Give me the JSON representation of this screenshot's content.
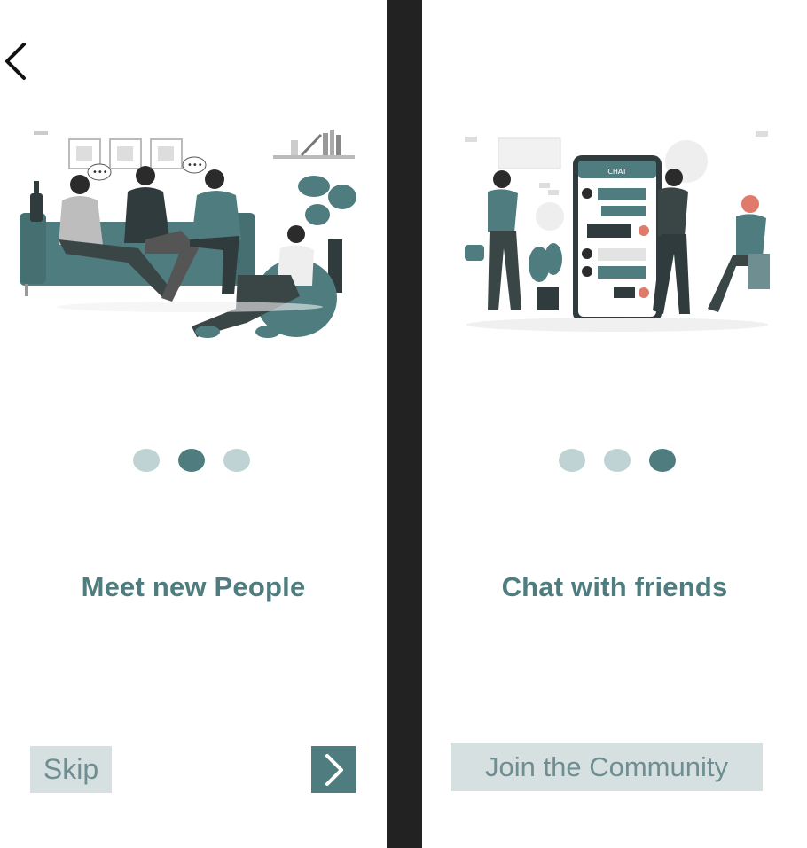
{
  "colors": {
    "accent": "#4f7d7f",
    "dot_inactive": "#bfd2d4",
    "button_bg": "#d7e0e1",
    "button_text": "#6f8e91",
    "divider": "#222222"
  },
  "left_screen": {
    "back_icon": "chevron-left-icon",
    "illustration": "friends-on-couch-illustration",
    "pager": {
      "total": 3,
      "active_index": 1
    },
    "title": "Meet new People",
    "skip_label": "Skip",
    "next_icon": "chevron-right-icon"
  },
  "right_screen": {
    "illustration": "chat-phone-illustration",
    "phone_header": "CHAT",
    "pager": {
      "total": 3,
      "active_index": 2
    },
    "title": "Chat with friends",
    "join_label": "Join the Community"
  }
}
